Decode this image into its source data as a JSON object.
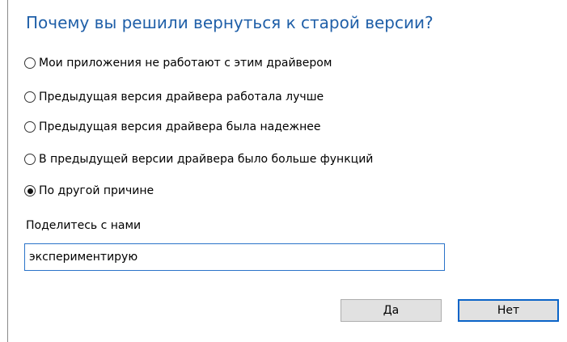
{
  "dialog": {
    "title": "Почему вы решили вернуться к старой версии?"
  },
  "reasons": [
    {
      "label": "Мои приложения не работают с этим драйвером",
      "selected": false
    },
    {
      "label": "Предыдущая версия драйвера работала лучше",
      "selected": false
    },
    {
      "label": "Предыдущая версия драйвера была надежнее",
      "selected": false
    },
    {
      "label": "В предыдущей версии драйвера было больше функций",
      "selected": false
    },
    {
      "label": "По другой причине",
      "selected": true
    }
  ],
  "feedback": {
    "label": "Поделитесь с нами",
    "value": "экспериментирую"
  },
  "buttons": {
    "yes_label": "Да",
    "no_label": "Нет"
  },
  "colors": {
    "title": "#1f5fa8",
    "field_border": "#2a73c9",
    "default_button_border": "#0a64c8",
    "button_background": "#e1e1e1"
  }
}
